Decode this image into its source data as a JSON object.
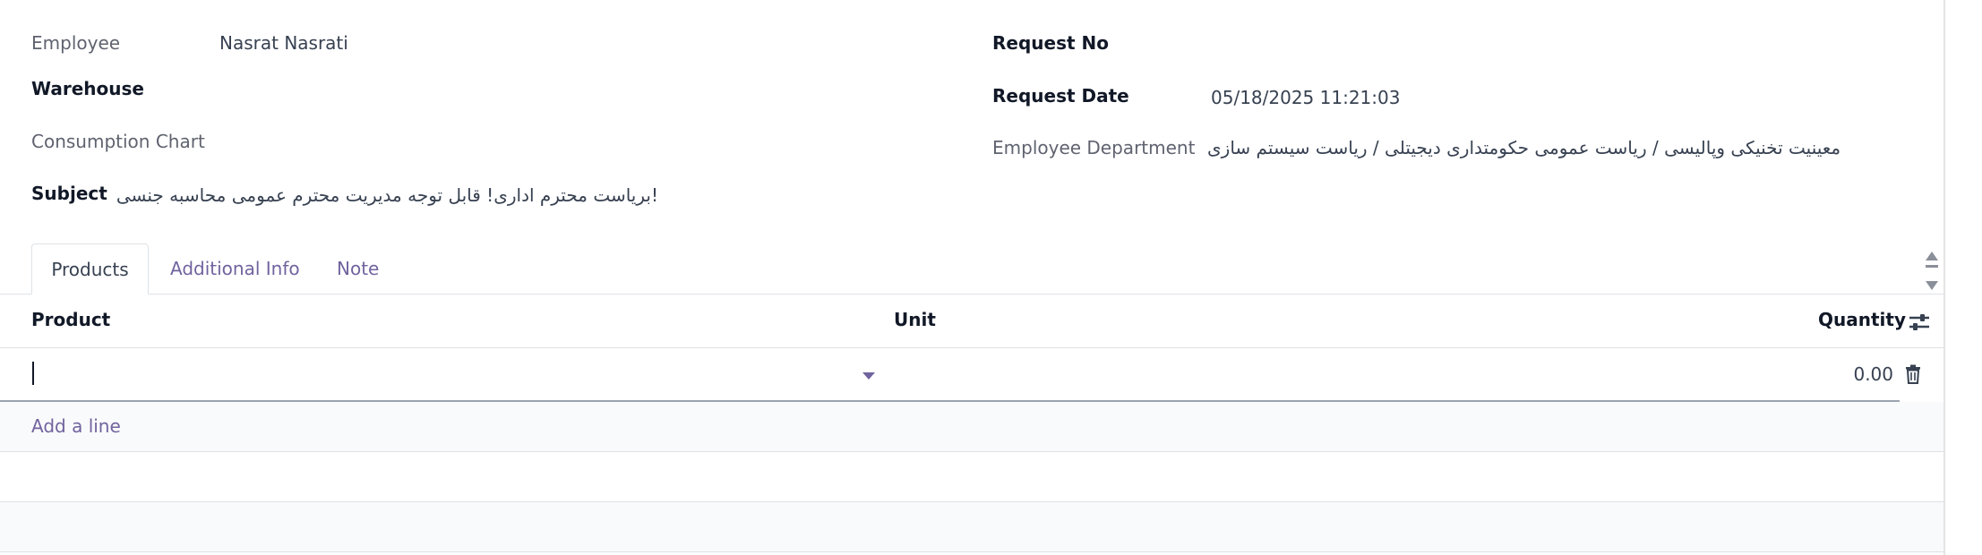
{
  "form": {
    "left": {
      "employee_label": "Employee",
      "employee_value": "Nasrat Nasrati",
      "warehouse_label": "Warehouse",
      "consumption_chart_label": "Consumption Chart",
      "subject_label": "Subject",
      "subject_value": "!بریاست محترم اداری! قابل توجه مدیریت محترم عمومی محاسبه جنسی"
    },
    "right": {
      "request_no_label": "Request No",
      "request_date_label": "Request Date",
      "request_date_value": "05/18/2025 11:21:03",
      "employee_department_label": "Employee Department",
      "employee_department_value": "معینیت تخنیکی وپالیسی / ریاست عمومی حکومتداری دیجیتلی / ریاست سیستم سازی"
    }
  },
  "tabs": [
    {
      "label": "Products",
      "active": true
    },
    {
      "label": "Additional Info",
      "active": false
    },
    {
      "label": "Note",
      "active": false
    }
  ],
  "table": {
    "columns": [
      "Product",
      "Unit",
      "Quantity"
    ],
    "rows": [
      {
        "product": "",
        "unit": "",
        "quantity": "0.00"
      }
    ],
    "add_line_label": "Add a line"
  },
  "icons": {
    "optional_columns": "sliders-icon",
    "delete_row": "trash-icon",
    "scroll_up": "triangle-up-icon",
    "scroll_down": "triangle-down-icon",
    "dropdown": "caret-down-icon"
  },
  "colors": {
    "accent": "#71639e",
    "label": "#5f636f",
    "text": "#374151"
  }
}
